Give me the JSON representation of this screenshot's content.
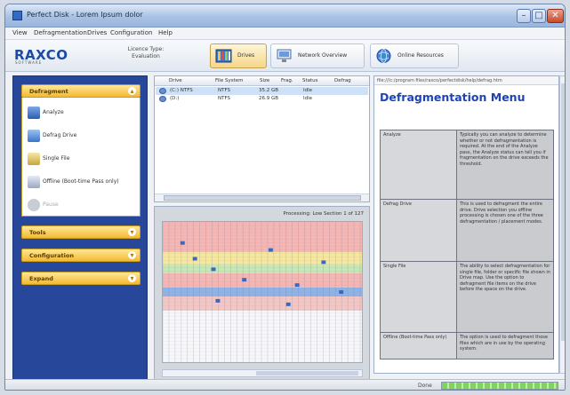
{
  "window": {
    "title": "Perfect Disk - Lorem Ipsum dolor",
    "controls": {
      "minimize": "–",
      "maximize": "□",
      "close": "✕"
    }
  },
  "menubar": {
    "items": [
      "View",
      "Defragmentation",
      "Drives",
      "Configuration",
      "Help"
    ]
  },
  "toolbar": {
    "logo": "RAXCO",
    "logo_sub": "SOFTWARE",
    "license_text": "Licence Type: Evaluation",
    "buttons": [
      {
        "label": "Drives",
        "icon": "drives-icon",
        "active": true
      },
      {
        "label": "Network Overview",
        "icon": "network-icon",
        "active": false
      },
      {
        "label": "Online Resources",
        "icon": "globe-icon",
        "active": false
      }
    ]
  },
  "sidebar": {
    "defragment": {
      "title": "Defragment",
      "items": [
        {
          "label": "Analyze",
          "icon": "analyze-icon",
          "disabled": false
        },
        {
          "label": "Defrag Drive",
          "icon": "drive-defrag-icon",
          "disabled": false
        },
        {
          "label": "Single File",
          "icon": "single-file-icon",
          "disabled": false
        },
        {
          "label": "Offline (Boot-time Pass only)",
          "icon": "offline-icon",
          "disabled": false
        },
        {
          "label": "Pause",
          "icon": "pause-icon",
          "disabled": true
        }
      ]
    },
    "tools": {
      "title": "Tools"
    },
    "configuration": {
      "title": "Configuration"
    },
    "expand": {
      "title": "Expand"
    }
  },
  "drive_list": {
    "columns": [
      "Drive",
      "File System",
      "Size",
      "Frag.",
      "Status",
      "Defrag"
    ],
    "rows": [
      {
        "drive": "(C:) NTFS",
        "fs": "NTFS",
        "size": "35.2 GB",
        "frag": "",
        "status": "Idle",
        "selected": true
      },
      {
        "drive": "(D:)",
        "fs": "NTFS",
        "size": "26.9 GB",
        "frag": "",
        "status": "Idle",
        "selected": false
      }
    ]
  },
  "map": {
    "progress_label": "Processing: Low Section 1 of 127"
  },
  "help": {
    "address": "file:///c:/program files/raxco/perfectdisk/help/defrag.htm",
    "title": "Defragmentation Menu",
    "rows": [
      {
        "name": "Analyze",
        "text": "Typically you can analyze to determine whether or not defragmentation is required. At the end of the Analyze pass, the Analyze status can tell you if fragmentation on the drive exceeds the threshold."
      },
      {
        "name": "Defrag Drive",
        "text": "This is used to defragment the entire drive. Drive selection you offline processing is chosen one of the three defragmentation / placement modes."
      },
      {
        "name": "Single File",
        "text": "The ability to select defragmentation for single file, folder or specific file shown in Drive map. Use the option to defragment file items on the drive before the space on the drive."
      },
      {
        "name": "Offline (Boot-time Pass only)",
        "text": "The option is used to defragment those files which are in use by the operating system."
      }
    ]
  },
  "status": {
    "label": "Done",
    "progress_percent": 100
  },
  "colors": {
    "sidebar_bg": "#27489a",
    "panel_accent": "#f4b92f",
    "help_title": "#1e43b7",
    "status_fill": "#7fd45c"
  }
}
